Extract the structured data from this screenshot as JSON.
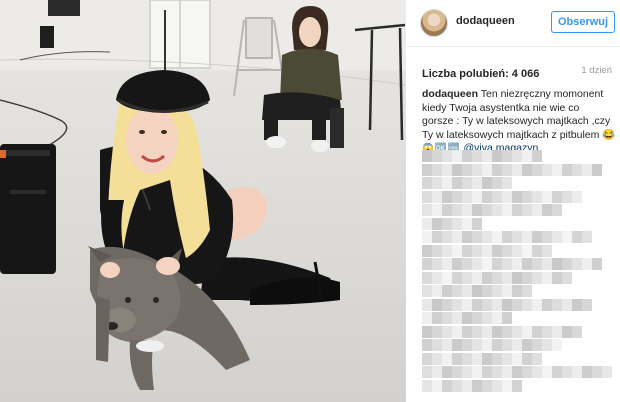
{
  "post": {
    "username": "dodaqueen",
    "follow_label": "Obserwuj",
    "likes_label": "Liczba polubień:",
    "likes_count": "4 066",
    "time_ago": "1 dzień",
    "caption_user": "dodaqueen",
    "caption_lines": [
      "Ten niezręczny momonent",
      "kiedy Twoja asystentka nie wie co",
      "gorsze : Ty w lateksowych majtkach ,czy",
      "Ty w lateksowych majtkach z pitbulem 😂"
    ],
    "caption_emojis": "😱🆗🆒",
    "caption_tags": [
      "@viva",
      "magazyn"
    ]
  },
  "icons": {
    "avatar": "avatar-icon",
    "pixelated_comments": "pixelated-comments"
  },
  "colors": {
    "accent": "#3897f0",
    "mention": "#003569",
    "text": "#262626",
    "muted": "#999999"
  }
}
